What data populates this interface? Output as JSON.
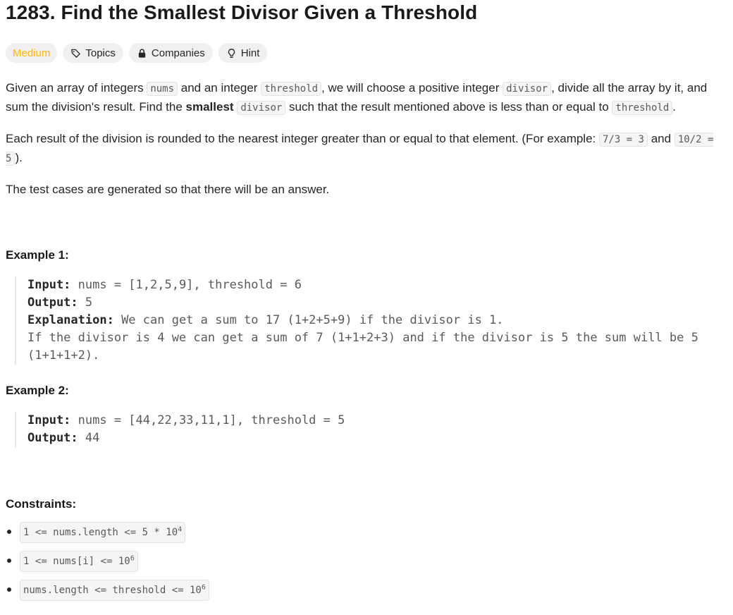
{
  "problem": {
    "title": "1283. Find the Smallest Divisor Given a Threshold"
  },
  "tags": {
    "difficulty": "Medium",
    "topics": "Topics",
    "companies": "Companies",
    "hint": "Hint"
  },
  "colors": {
    "difficulty_medium": "#ffb800",
    "tag_bg": "#f0f0f0",
    "text": "#262626"
  },
  "description": {
    "p1_a": "Given an array of integers ",
    "p1_code1": "nums",
    "p1_b": " and an integer ",
    "p1_code2": "threshold",
    "p1_c": ", we will choose a positive integer ",
    "p1_code3": "divisor",
    "p1_d": ", divide all the array by it, and sum the division's result. Find the ",
    "p1_bold": "smallest",
    "p1_e": " ",
    "p1_code4": "divisor",
    "p1_f": " such that the result mentioned above is less than or equal to ",
    "p1_code5": "threshold",
    "p1_g": ".",
    "p2_a": "Each result of the division is rounded to the nearest integer greater than or equal to that element. (For example: ",
    "p2_code1": "7/3 = 3",
    "p2_b": " and ",
    "p2_code2": "10/2 = 5",
    "p2_c": ").",
    "p3": "The test cases are generated so that there will be an answer."
  },
  "examples": [
    {
      "title": "Example 1:",
      "input_label": "Input:",
      "input": " nums = [1,2,5,9], threshold = 6",
      "output_label": "Output:",
      "output": " 5",
      "explanation_label": "Explanation:",
      "explanation_1": " We can get a sum to 17 (1+2+5+9) if the divisor is 1.",
      "explanation_2": "If the divisor is 4 we can get a sum of 7 (1+1+2+3) and if the divisor is 5 the sum will be 5",
      "explanation_3": "(1+1+1+2)."
    },
    {
      "title": "Example 2:",
      "input_label": "Input:",
      "input": " nums = [44,22,33,11,1], threshold = 5",
      "output_label": "Output:",
      "output": " 44"
    }
  ],
  "constraints": {
    "title": "Constraints:",
    "c1_a": "1 <= nums.length <= 5 * 10",
    "c1_sup": "4",
    "c2_a": "1 <= nums[i] <= 10",
    "c2_sup": "6",
    "c3_a": "nums.length <= threshold <= 10",
    "c3_sup": "6"
  }
}
